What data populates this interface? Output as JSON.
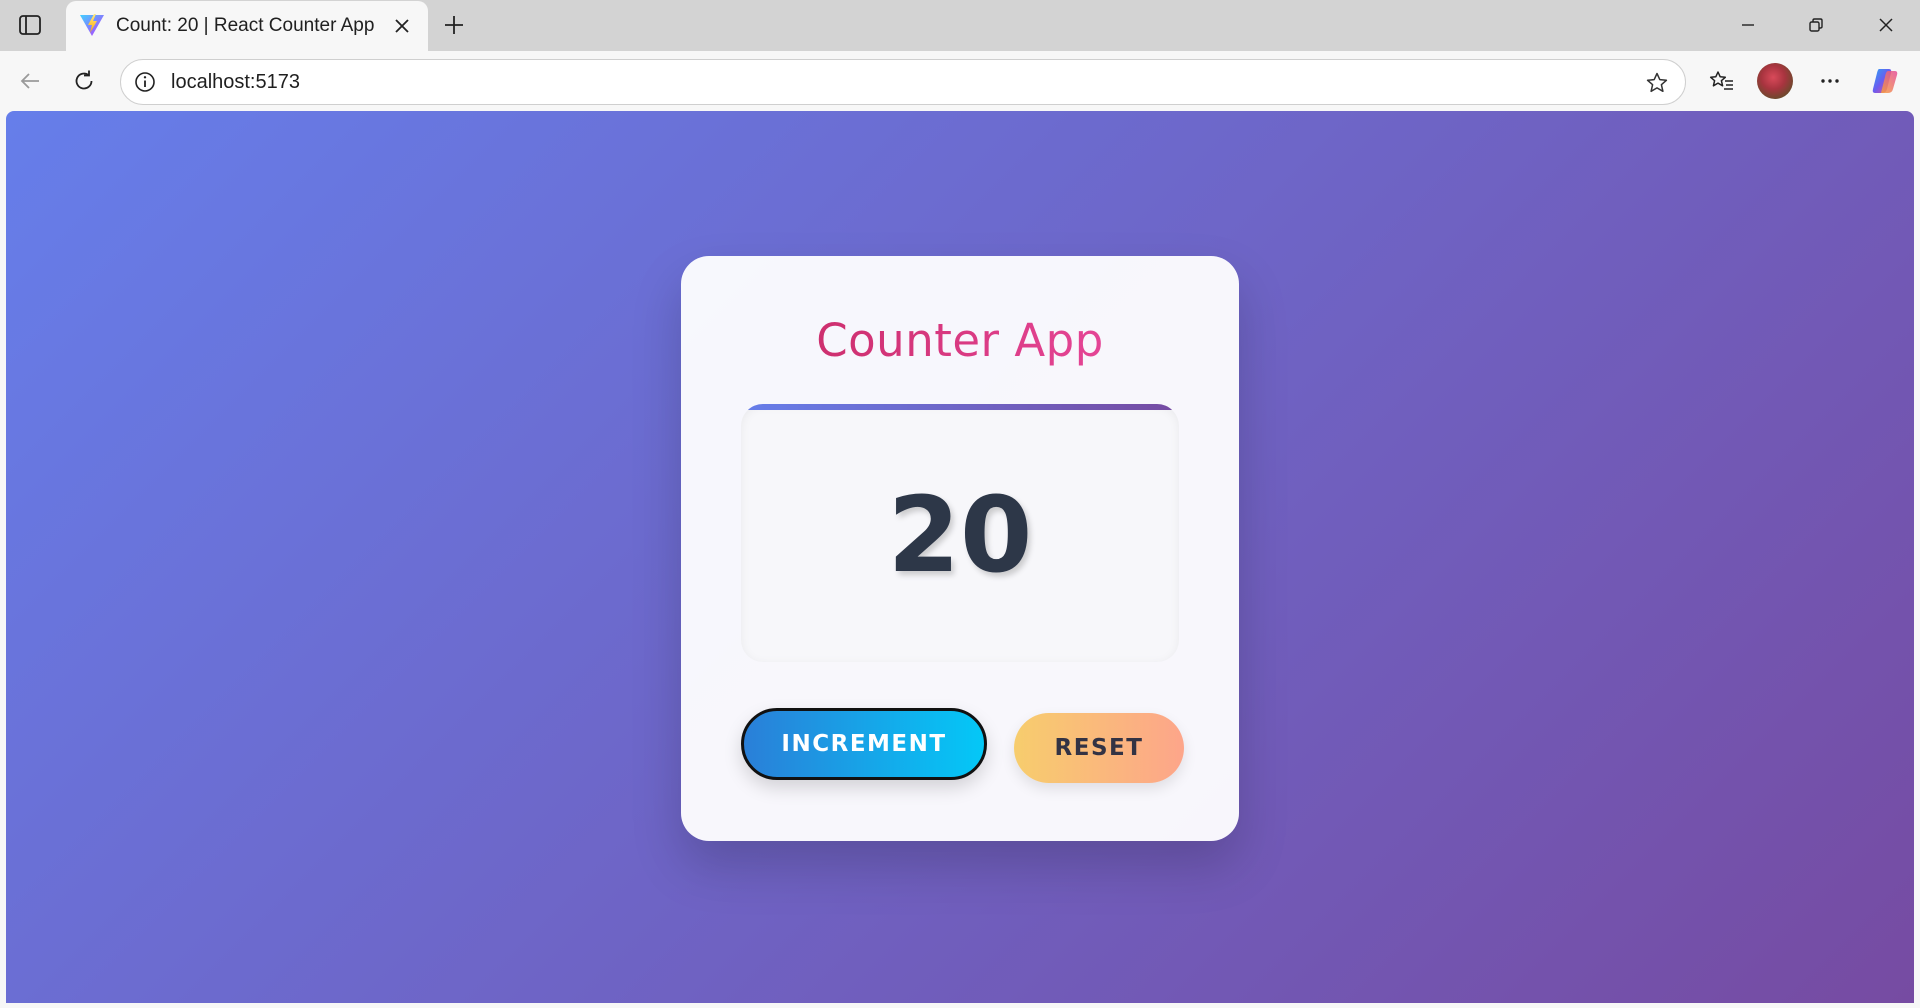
{
  "browser": {
    "tab": {
      "title": "Count: 20 | React Counter App",
      "favicon": "vite-logo-icon"
    },
    "address": {
      "url": "localhost:5173"
    },
    "icons": {
      "tab_list": "tab-list-icon",
      "close_tab": "close-icon",
      "new_tab": "plus-icon",
      "back": "back-arrow-icon",
      "reload": "reload-icon",
      "site_info": "info-icon",
      "favorite": "star-icon",
      "favorites": "favorites-icon",
      "profile": "avatar",
      "more": "more-icon",
      "copilot": "copilot-icon",
      "minimize": "minimize-icon",
      "restore": "restore-icon",
      "close_window": "close-icon"
    }
  },
  "app": {
    "title": "Counter App",
    "count": "20",
    "buttons": {
      "increment": "INCREMENT",
      "reset": "RESET"
    }
  },
  "colors": {
    "background_start": "#667eea",
    "background_end": "#764ba2",
    "title_gradient_start": "#c2255c",
    "title_gradient_end": "#f04fa8",
    "count_color": "#2d3748",
    "increment_start": "#2a7fd8",
    "increment_end": "#04c8f7",
    "reset_start": "#f7cd6d",
    "reset_end": "#fda58a"
  }
}
